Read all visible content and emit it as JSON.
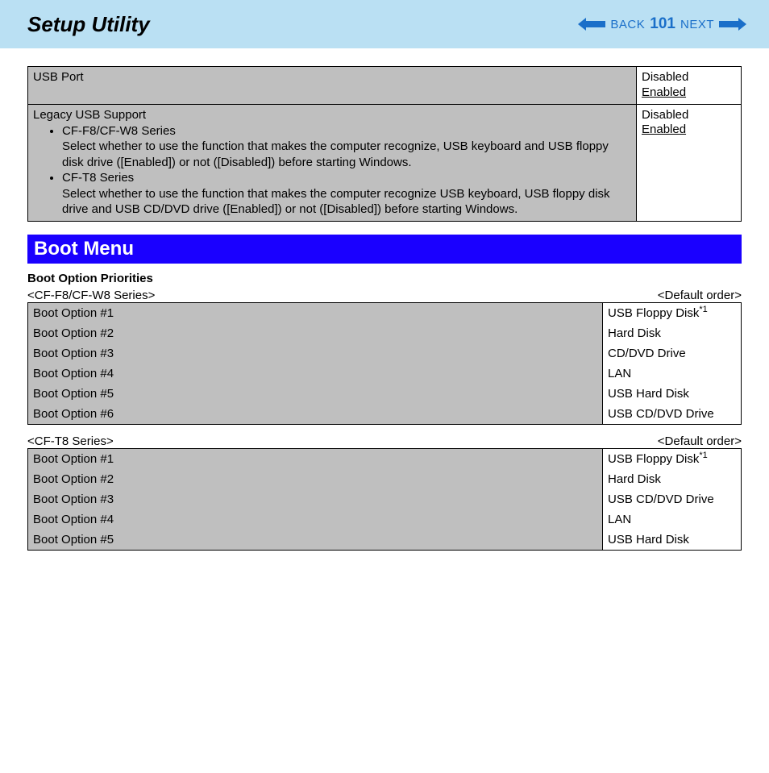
{
  "header": {
    "title": "Setup Utility",
    "back": "BACK",
    "page": "101",
    "next": "NEXT"
  },
  "usb_table": {
    "rows": [
      {
        "label": "USB Port",
        "options": [
          "Disabled",
          "Enabled"
        ]
      },
      {
        "label": "Legacy USB Support",
        "options": [
          "Disabled",
          "Enabled"
        ],
        "items": [
          {
            "series": "CF-F8/CF-W8 Series",
            "desc": "Select whether to use the function that makes the computer recognize, USB keyboard and USB floppy disk drive ([Enabled]) or not ([Disabled]) before starting Windows."
          },
          {
            "series": "CF-T8 Series",
            "desc": "Select whether to use the function that makes the computer recognize USB keyboard, USB floppy disk drive and USB CD/DVD drive ([Enabled]) or not ([Disabled]) before starting Windows."
          }
        ]
      }
    ]
  },
  "boot": {
    "heading": "Boot Menu",
    "subheading": "Boot Option Priorities",
    "default_order_label": "<Default order>",
    "groups": [
      {
        "series": "<CF-F8/CF-W8 Series>",
        "rows": [
          {
            "label": "Boot Option #1",
            "value": "USB Floppy Disk",
            "note": "*1"
          },
          {
            "label": "Boot Option #2",
            "value": "Hard Disk"
          },
          {
            "label": "Boot Option #3",
            "value": "CD/DVD Drive"
          },
          {
            "label": "Boot Option #4",
            "value": "LAN"
          },
          {
            "label": "Boot Option #5",
            "value": "USB Hard Disk"
          },
          {
            "label": "Boot Option #6",
            "value": "USB CD/DVD Drive"
          }
        ]
      },
      {
        "series": "<CF-T8 Series>",
        "rows": [
          {
            "label": "Boot Option #1",
            "value": "USB Floppy Disk",
            "note": "*1"
          },
          {
            "label": "Boot Option #2",
            "value": "Hard Disk"
          },
          {
            "label": "Boot Option #3",
            "value": "USB CD/DVD Drive"
          },
          {
            "label": "Boot Option #4",
            "value": "LAN"
          },
          {
            "label": "Boot Option #5",
            "value": "USB Hard Disk"
          }
        ]
      }
    ]
  }
}
